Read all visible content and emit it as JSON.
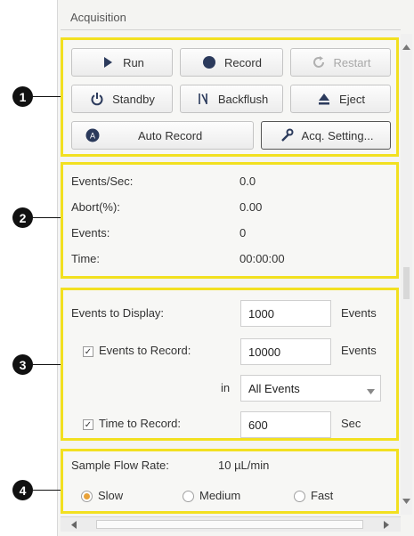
{
  "panel": {
    "title": "Acquisition"
  },
  "callouts": [
    "1",
    "2",
    "3",
    "4"
  ],
  "controls": {
    "run": "Run",
    "record": "Record",
    "restart": "Restart",
    "standby": "Standby",
    "backflush": "Backflush",
    "eject": "Eject",
    "auto_record": "Auto Record",
    "acq_setting": "Acq. Setting..."
  },
  "stats": {
    "rows": [
      {
        "label": "Events/Sec:",
        "value": "0.0"
      },
      {
        "label": "Abort(%):",
        "value": "0.00"
      },
      {
        "label": "Events:",
        "value": "0"
      },
      {
        "label": "Time:",
        "value": "00:00:00"
      }
    ]
  },
  "settings": {
    "events_to_display": {
      "label": "Events to Display:",
      "value": "1000",
      "unit": "Events"
    },
    "events_to_record": {
      "label": "Events to Record:",
      "value": "10000",
      "unit": "Events",
      "checked": true
    },
    "in": {
      "label": "in",
      "selected": "All Events"
    },
    "time_to_record": {
      "label": "Time to Record:",
      "value": "600",
      "unit": "Sec",
      "checked": true
    }
  },
  "flow": {
    "label": "Sample Flow Rate:",
    "value": "10 µL/min",
    "options": [
      "Slow",
      "Medium",
      "Fast"
    ],
    "selected": "Slow"
  },
  "colors": {
    "highlight": "#f2e020",
    "radio_selected": "#e8a23a",
    "callout": "#111111"
  },
  "icons": [
    "play-icon",
    "record-dot-icon",
    "restart-icon",
    "power-icon",
    "backflush-icon",
    "eject-icon",
    "auto-record-icon",
    "wrench-icon",
    "dropdown-arrow-icon"
  ]
}
